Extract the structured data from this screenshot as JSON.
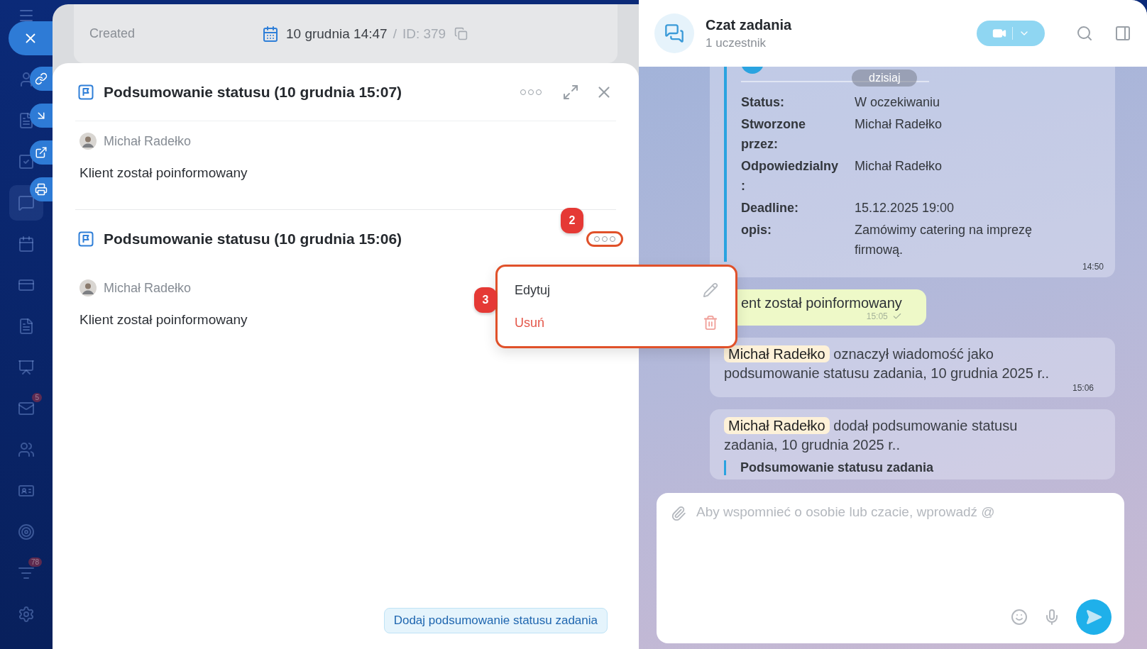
{
  "sidebar": {
    "mail_badge": "5",
    "feed_badge": "78"
  },
  "task_header": {
    "created_label": "Created",
    "date": "10 grudnia 14:47",
    "separator": "/",
    "id": "ID: 379"
  },
  "summaries": [
    {
      "title": "Podsumowanie statusu (10 grudnia 15:07)",
      "author": "Michał Radełko",
      "text": "Klient został poinformowany"
    },
    {
      "title": "Podsumowanie statusu (10 grudnia 15:06)",
      "author": "Michał Radełko",
      "text": "Klient został poinformowany"
    }
  ],
  "add_button": "Dodaj podsumowanie statusu zadania",
  "context_menu": {
    "items": [
      {
        "kind": "edit",
        "label": "Edytuj"
      },
      {
        "kind": "delete",
        "label": "Usuń"
      }
    ]
  },
  "annotations": [
    {
      "number": "2"
    },
    {
      "number": "3"
    }
  ],
  "chat": {
    "title": "Czat zadania",
    "subtitle": "1 uczestnik",
    "date_pill": "dzisiaj",
    "task_card": {
      "fields": [
        {
          "label": "Status:",
          "value": "W oczekiwaniu"
        },
        {
          "label": "Stworzone przez:",
          "value": "Michał Radełko"
        },
        {
          "label": "Odpowiedzialny:",
          "value": "Michał Radełko"
        },
        {
          "label": "Deadline:",
          "value": "15.12.2025 19:00"
        },
        {
          "label": "opis:",
          "value": "Zamówimy catering na imprezę firmową."
        }
      ],
      "time": "14:50"
    },
    "messages": [
      {
        "kind": "own",
        "text": "ent został poinformowany",
        "time": "15:05",
        "read": true
      },
      {
        "kind": "system",
        "mention": "Michał Radełko",
        "text": "oznaczył wiadomość jako podsumowanie statusu zadania, 10 grudnia 2025 r..",
        "time": "15:06"
      },
      {
        "kind": "system",
        "mention": "Michał Radełko",
        "text": "dodał podsumowanie statusu zadania, 10 grudnia 2025 r..",
        "quote": "Podsumowanie statusu zadania"
      }
    ],
    "input": {
      "placeholder": "Aby wspomnieć o osobie lub czacie, wprowadź @"
    }
  }
}
